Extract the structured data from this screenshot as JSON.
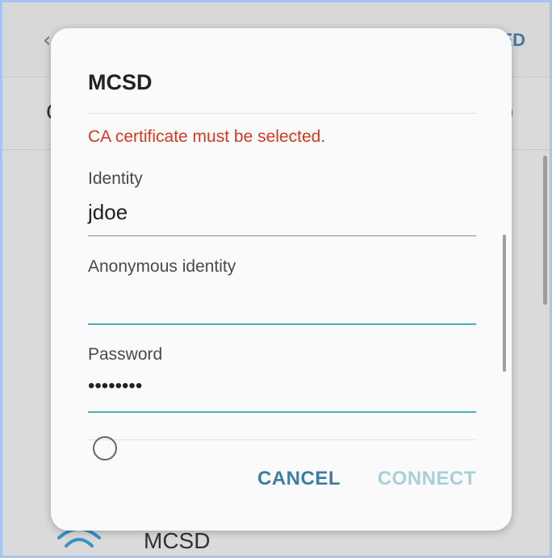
{
  "background": {
    "top_action": "ED",
    "row_letter": "C",
    "row_right": ")",
    "bottom_network": "MCSD"
  },
  "dialog": {
    "title": "MCSD",
    "error": "CA certificate must be selected.",
    "identity_label": "Identity",
    "identity_value": "jdoe",
    "anon_label": "Anonymous identity",
    "anon_value": "",
    "password_label": "Password",
    "password_value": "••••••••",
    "cancel_label": "CANCEL",
    "connect_label": "CONNECT"
  },
  "colors": {
    "error": "#d4391f",
    "accent": "#3a7fa1",
    "disabled": "#a9cfd9",
    "focus_line": "#4fb0bd"
  }
}
